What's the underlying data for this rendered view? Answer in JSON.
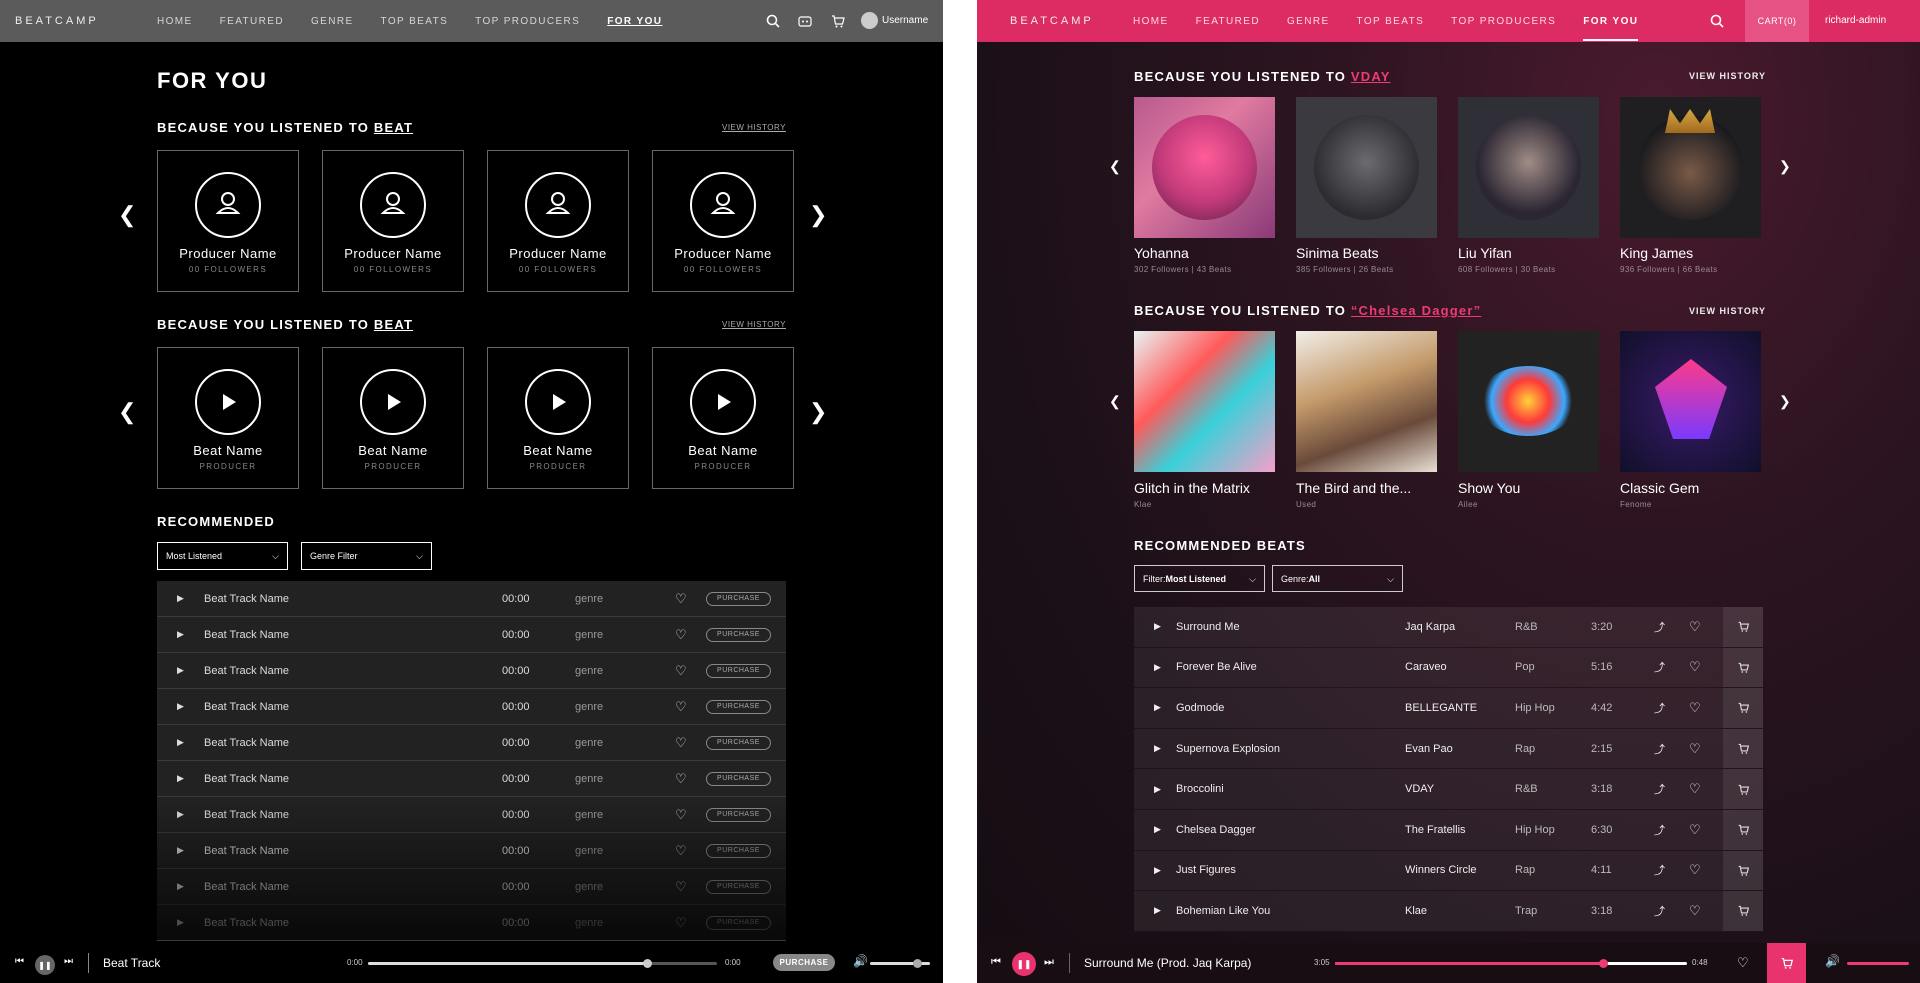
{
  "wireframe": {
    "logo": "BEATCAMP",
    "nav": [
      "HOME",
      "FEATURED",
      "GENRE",
      "TOP BEATS",
      "TOP PRODUCERS",
      "FOR YOU"
    ],
    "active_nav": "FOR YOU",
    "username": "Username",
    "page_title": "FOR YOU",
    "section1": {
      "prefix": "BECAUSE YOU LISTENED TO ",
      "highlight": "BEAT",
      "history": "VIEW HISTORY",
      "cards": [
        {
          "name": "Producer Name",
          "sub": "00 FOLLOWERS"
        },
        {
          "name": "Producer Name",
          "sub": "00 FOLLOWERS"
        },
        {
          "name": "Producer Name",
          "sub": "00 FOLLOWERS"
        },
        {
          "name": "Producer Name",
          "sub": "00 FOLLOWERS"
        }
      ]
    },
    "section2": {
      "prefix": "BECAUSE YOU LISTENED TO ",
      "highlight": "BEAT",
      "history": "VIEW HISTORY",
      "cards": [
        {
          "name": "Beat Name",
          "sub": "PRODUCER"
        },
        {
          "name": "Beat Name",
          "sub": "PRODUCER"
        },
        {
          "name": "Beat Name",
          "sub": "PRODUCER"
        },
        {
          "name": "Beat Name",
          "sub": "PRODUCER"
        }
      ]
    },
    "recommended": "RECOMMENDED",
    "filter1": "Most Listened",
    "filter2": "Genre Filter",
    "rows": [
      {
        "name": "Beat Track Name",
        "time": "00:00",
        "genre": "genre",
        "action": "PURCHASE"
      },
      {
        "name": "Beat Track Name",
        "time": "00:00",
        "genre": "genre",
        "action": "PURCHASE"
      },
      {
        "name": "Beat Track Name",
        "time": "00:00",
        "genre": "genre",
        "action": "PURCHASE"
      },
      {
        "name": "Beat Track Name",
        "time": "00:00",
        "genre": "genre",
        "action": "PURCHASE"
      },
      {
        "name": "Beat Track Name",
        "time": "00:00",
        "genre": "genre",
        "action": "PURCHASE"
      },
      {
        "name": "Beat Track Name",
        "time": "00:00",
        "genre": "genre",
        "action": "PURCHASE"
      },
      {
        "name": "Beat Track Name",
        "time": "00:00",
        "genre": "genre",
        "action": "PURCHASE"
      },
      {
        "name": "Beat Track Name",
        "time": "00:00",
        "genre": "genre",
        "action": "PURCHASE"
      },
      {
        "name": "Beat Track Name",
        "time": "00:00",
        "genre": "genre",
        "action": "PURCHASE"
      },
      {
        "name": "Beat Track Name",
        "time": "00:00",
        "genre": "genre",
        "action": "PURCHASE"
      }
    ],
    "player": {
      "track": "Beat Track",
      "start": "0:00",
      "end": "0:00",
      "purchase": "PURCHASE",
      "progress": 0.8
    }
  },
  "design": {
    "logo": "BEATCAMP",
    "nav": [
      "HOME",
      "FEATURED",
      "GENRE",
      "TOP BEATS",
      "TOP PRODUCERS",
      "FOR YOU"
    ],
    "active_nav": "FOR YOU",
    "cart": "CART(0)",
    "admin": "richard-admin",
    "section1": {
      "prefix": "BECAUSE YOU LISTENED TO ",
      "highlight": "VDAY",
      "history": "VIEW HISTORY",
      "cards": [
        {
          "name": "Yohanna",
          "sub": "302 Followers | 43 Beats"
        },
        {
          "name": "Sinima Beats",
          "sub": "385 Followers | 26 Beats"
        },
        {
          "name": "Liu Yifan",
          "sub": "608 Followers | 30 Beats"
        },
        {
          "name": "King James",
          "sub": "936 Followers | 66 Beats"
        }
      ]
    },
    "section2": {
      "prefix": "BECAUSE YOU LISTENED TO ",
      "highlight": "“Chelsea Dagger”",
      "history": "VIEW HISTORY",
      "cards": [
        {
          "name": "Glitch in the Matrix",
          "sub": "Klae"
        },
        {
          "name": "The Bird and the...",
          "sub": "Used"
        },
        {
          "name": "Show You",
          "sub": "Ailee"
        },
        {
          "name": "Classic Gem",
          "sub": "Fenome"
        }
      ]
    },
    "recommended": "RECOMMENDED BEATS",
    "filter1_label": "Filter: ",
    "filter1": "Most Listened",
    "filter2_label": "Genre: ",
    "filter2": "All",
    "rows": [
      {
        "name": "Surround Me",
        "artist": "Jaq Karpa",
        "genre": "R&B",
        "time": "3:20"
      },
      {
        "name": "Forever Be Alive",
        "artist": "Caraveo",
        "genre": "Pop",
        "time": "5:16"
      },
      {
        "name": "Godmode",
        "artist": "BELLEGANTE",
        "genre": "Hip Hop",
        "time": "4:42"
      },
      {
        "name": "Supernova Explosion",
        "artist": "Evan Pao",
        "genre": "Rap",
        "time": "2:15"
      },
      {
        "name": "Broccolini",
        "artist": "VDAY",
        "genre": "R&B",
        "time": "3:18"
      },
      {
        "name": "Chelsea Dagger",
        "artist": "The Fratellis",
        "genre": "Hip Hop",
        "time": "6:30"
      },
      {
        "name": "Just Figures",
        "artist": "Winners Circle",
        "genre": "Rap",
        "time": "4:11"
      },
      {
        "name": "Bohemian Like You",
        "artist": "Klae",
        "genre": "Trap",
        "time": "3:18"
      }
    ],
    "player": {
      "track": "Surround Me (Prod. Jaq Karpa)",
      "start": "3:05",
      "end": "0:48",
      "progress": 0.76
    },
    "accent": "#dd2b63"
  }
}
